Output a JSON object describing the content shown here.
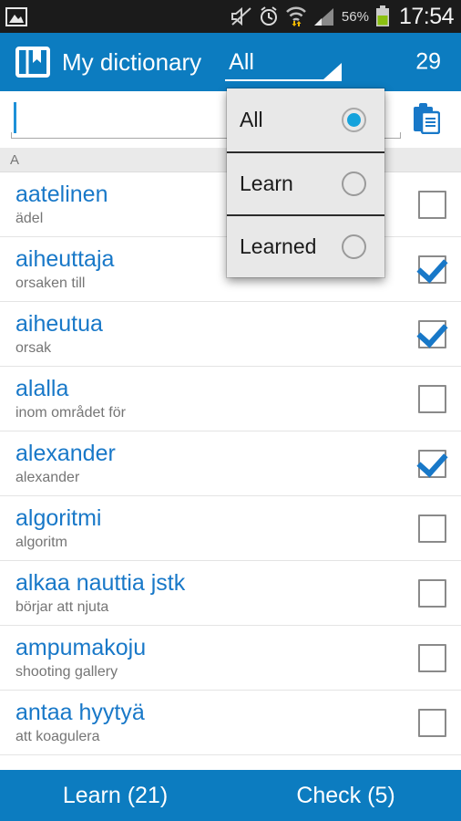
{
  "statusbar": {
    "icons": [
      "image-icon",
      "mute-icon",
      "alarm-icon",
      "wifi-icon",
      "signal-icon"
    ],
    "battery_percent": "56%",
    "clock": "17:54"
  },
  "actionbar": {
    "app_icon": "book-icon",
    "title": "My dictionary",
    "filter_label": "All",
    "count": "29"
  },
  "search": {
    "value": "",
    "placeholder": "",
    "paste_icon": "clipboard-icon"
  },
  "dropdown": {
    "visible": true,
    "items": [
      {
        "label": "All",
        "selected": true
      },
      {
        "label": "Learn",
        "selected": false
      },
      {
        "label": "Learned",
        "selected": false
      }
    ]
  },
  "list": {
    "section_header": "A",
    "rows": [
      {
        "word": "aatelinen",
        "translation": "ädel",
        "checked": false
      },
      {
        "word": "aiheuttaja",
        "translation": "orsaken till",
        "checked": true
      },
      {
        "word": "aiheutua",
        "translation": "orsak",
        "checked": true
      },
      {
        "word": "alalla",
        "translation": "inom området för",
        "checked": false
      },
      {
        "word": "alexander",
        "translation": "alexander",
        "checked": true
      },
      {
        "word": "algoritmi",
        "translation": "algoritm",
        "checked": false
      },
      {
        "word": "alkaa nauttia jstk",
        "translation": "börjar att njuta",
        "checked": false
      },
      {
        "word": "ampumakoju",
        "translation": "shooting gallery",
        "checked": false
      },
      {
        "word": "antaa hyytyä",
        "translation": "att koagulera",
        "checked": false
      }
    ]
  },
  "bottombar": {
    "learn_label": "Learn (21)",
    "check_label": "Check (5)"
  },
  "colors": {
    "accent": "#0c7cc0",
    "word": "#1878c8",
    "translation": "#757575",
    "statusbar_bg": "#1b1b1b",
    "section_bg": "#eaeaea",
    "dropdown_bg": "#e8e8e8",
    "radio_fill": "#14a2dc"
  }
}
